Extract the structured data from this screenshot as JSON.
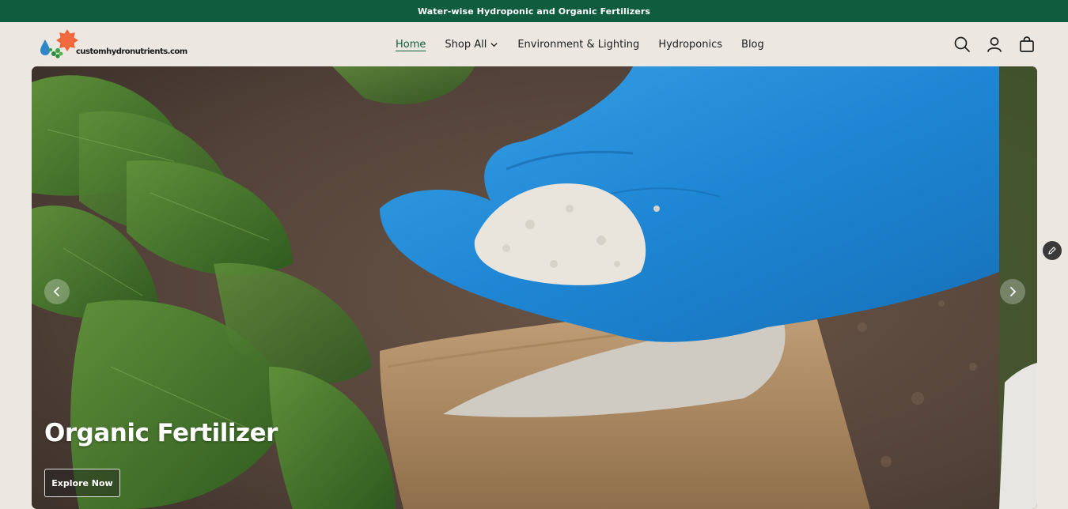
{
  "announcement": {
    "text": "Water-wise Hydroponic and Organic Fertilizers"
  },
  "header": {
    "logo_text": "customhydronutrients.com",
    "nav": [
      {
        "label": "Home",
        "active": true
      },
      {
        "label": "Shop All",
        "has_dropdown": true
      },
      {
        "label": "Environment & Lighting"
      },
      {
        "label": "Hydroponics"
      },
      {
        "label": "Blog"
      }
    ],
    "icons": [
      "search-icon",
      "account-icon",
      "cart-icon"
    ]
  },
  "hero": {
    "title": "Organic Fertilizer",
    "button_label": "Explore Now",
    "prev_icon": "chevron-left-icon",
    "next_icon": "chevron-right-icon"
  },
  "colors": {
    "announcement_bg": "#0f5c3f",
    "page_bg": "#ece8e1",
    "active_nav": "#0f5c3f"
  },
  "floating": {
    "edit_icon": "pencil-icon"
  }
}
